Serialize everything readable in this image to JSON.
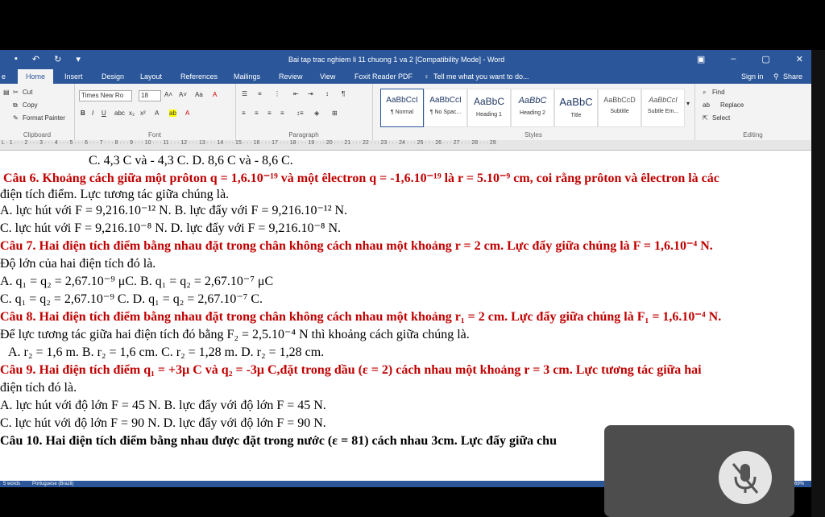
{
  "window": {
    "title": "Bai tap trac nghiem li 11 chuong 1 va 2 [Compatibility Mode] - Word",
    "sign_in": "Sign in",
    "share": "Share"
  },
  "tabs": [
    "Home",
    "Insert",
    "Design",
    "Layout",
    "References",
    "Mailings",
    "Review",
    "View",
    "Foxit Reader PDF"
  ],
  "tell_me": "Tell me what you want to do...",
  "clipboard": {
    "cut": "Cut",
    "copy": "Copy",
    "format_painter": "Format Painter",
    "label": "Clipboard"
  },
  "font": {
    "name": "Times New Ro",
    "size": "18",
    "label": "Font"
  },
  "paragraph": {
    "label": "Paragraph"
  },
  "styles": {
    "items": [
      {
        "preview": "AaBbCcI",
        "name": "¶ Normal"
      },
      {
        "preview": "AaBbCcI",
        "name": "¶ No Spac..."
      },
      {
        "preview": "AaBbC",
        "name": "Heading 1"
      },
      {
        "preview": "AaBbC",
        "name": "Heading 2"
      },
      {
        "preview": "AaBbC",
        "name": "Title"
      },
      {
        "preview": "AaBbCcD",
        "name": "Subtitle"
      },
      {
        "preview": "AaBbCcI",
        "name": "Subtle Em..."
      }
    ],
    "label": "Styles"
  },
  "editing": {
    "find": "Find",
    "replace": "Replace",
    "select": "Select",
    "label": "Editing"
  },
  "doc_lines": [
    "C. 4,3 C và - 4,3 C.                      D. 8,6 C và - 8,6 C.",
    "Câu 6. Khoảng cách giữa một prôton q = 1,6.10⁻¹⁹ và một êlectron q = -1,6.10⁻¹⁹ là r = 5.10⁻⁹ cm, coi rằng prôton và êlectron là các",
    "điện tích điểm. Lực tương tác giữa chúng là.",
    "A. lực hút với F = 9,216.10⁻¹² N.   B. lực đẩy với F = 9,216.10⁻¹² N.",
    "C. lực hút với F = 9,216.10⁻⁸ N.    D. lực đẩy với F = 9,216.10⁻⁸ N.",
    "Câu 7. Hai điện tích điểm bằng nhau đặt trong chân không cách nhau một khoảng r = 2 cm. Lực đẩy giữa chúng là F = 1,6.10⁻⁴ N.",
    "Độ lớn của hai điện tích đó là.",
    "A. q₁ = q₂ = 2,67.10⁻⁹ μC.              B. q₁ = q₂ = 2,67.10⁻⁷ μC",
    "C. q₁ = q₂ = 2,67.10⁻⁹ C.               D. q₁ = q₂ = 2,67.10⁻⁷ C.",
    "Câu 8. Hai điện tích điểm bằng nhau đặt trong chân không cách nhau một khoảng r₁ = 2 cm. Lực đẩy giữa chúng là F₁ = 1,6.10⁻⁴ N.",
    "Để lực tương tác giữa hai điện tích đó bằng F₂ = 2,5.10⁻⁴ N thì khoảng cách giữa chúng là.",
    "A. r₂ = 1,6 m.          B. r₂ = 1,6 cm.  C. r₂ = 1,28 m.          D. r₂ = 1,28 cm.",
    "Câu 9.  Hai điện tích điểm q₁ = +3μ C và q₂ = -3μ C,đặt trong dầu (ε = 2) cách nhau một khoảng r = 3 cm. Lực tương tác giữa hai",
    "điện tích đó là.",
    "A. lực hút với độ lớn F = 45 N.    B. lực đẩy với độ lớn F = 45 N.",
    "C. lực hút với độ lớn F = 90 N.    D. lực đẩy với độ lớn F = 90 N.",
    "Câu 10. Hai điện tích điểm bằng nhau được đặt trong nước (ε = 81) cách nhau 3cm. Lực đẩy giữa chu"
  ],
  "status": {
    "words": "5 words",
    "language": "Portuguese (Brazil)",
    "zoom": "69%"
  }
}
